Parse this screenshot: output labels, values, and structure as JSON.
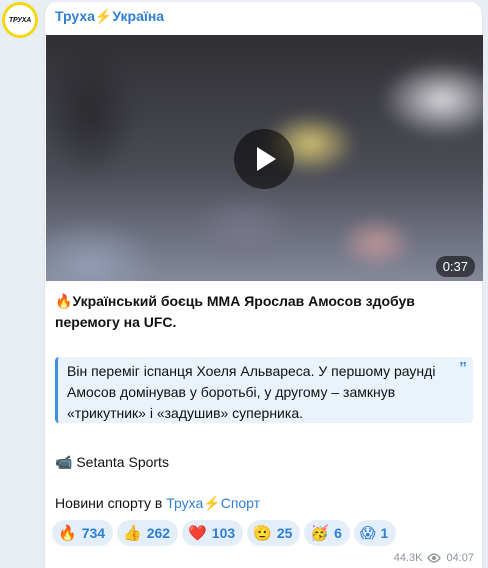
{
  "channel": {
    "name_part1": "Труха",
    "bolt": "⚡",
    "name_part2": "Україна",
    "avatar_text": "ТРУХА"
  },
  "video": {
    "duration": "0:37"
  },
  "post": {
    "headline_emoji": "🔥",
    "headline": "Український боєць ММА Ярослав Амосов здобув перемогу на UFC.",
    "quote": "Він переміг іспанця Хоеля Альвареса. У першому раунді Амосов домінував у боротьбі, у другому – замкнув «трикутник» і «задушив» суперника.",
    "quote_mark": "”",
    "source_icon": "📹",
    "source": "Setanta Sports",
    "footer_prefix": "Новини спорту в ",
    "footer_link_part1": "Труха",
    "footer_link_bolt": "⚡",
    "footer_link_part2": "Спорт"
  },
  "reactions": [
    {
      "emoji": "🔥",
      "count": "734"
    },
    {
      "emoji": "👍",
      "count": "262"
    },
    {
      "emoji": "❤️",
      "count": "103"
    },
    {
      "emoji": "🫡",
      "count": "25"
    },
    {
      "emoji": "🥳",
      "count": "6"
    },
    {
      "emoji": "😱",
      "count": "1"
    }
  ],
  "meta": {
    "views": "44.3K",
    "time": "04:07"
  }
}
